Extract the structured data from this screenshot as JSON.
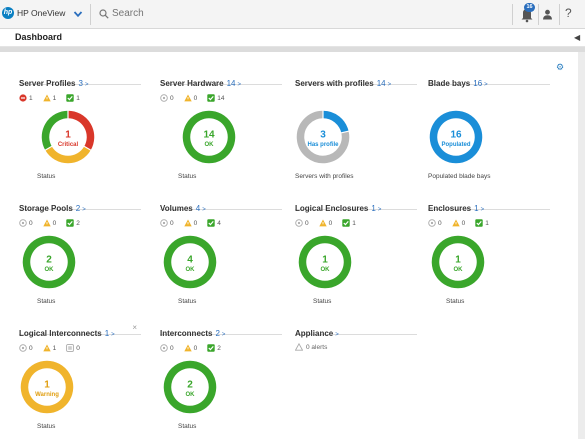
{
  "topbar": {
    "logo_text": "hp",
    "app_name": "HP OneView",
    "search_placeholder": "Search",
    "notification_count": "16",
    "help": "?"
  },
  "header": {
    "title": "Dashboard",
    "collapse": "◀"
  },
  "colors": {
    "ok": "#3aa62b",
    "critical": "#d9372a",
    "warning": "#f0b42c",
    "blue": "#1a8ed8",
    "grey": "#b8b8b8"
  },
  "panels": [
    {
      "title": "Server Profiles",
      "count": "3",
      "arrow": ">",
      "counts": [
        "1",
        "1",
        "1"
      ],
      "count_types": [
        "critical",
        "warning",
        "ok"
      ],
      "donut_value": "1",
      "donut_label": "Critical",
      "label_color": "#d9372a",
      "segments": [
        {
          "color": "#d9372a",
          "value": 1
        },
        {
          "color": "#f0b42c",
          "value": 1
        },
        {
          "color": "#3aa62b",
          "value": 1
        }
      ],
      "footer": "Status"
    },
    {
      "title": "Server Hardware",
      "count": "14",
      "arrow": ">",
      "counts": [
        "0",
        "0",
        "14"
      ],
      "count_types": [
        "unknown",
        "warning",
        "ok"
      ],
      "donut_value": "14",
      "donut_label": "OK",
      "label_color": "#3aa62b",
      "segments": [
        {
          "color": "#3aa62b",
          "value": 1
        }
      ],
      "footer": "Status"
    },
    {
      "title": "Servers with profiles",
      "count": "14",
      "arrow": ">",
      "counts": [],
      "count_types": [],
      "donut_value": "3",
      "donut_label": "Has profile",
      "label_color": "#1a8ed8",
      "segments": [
        {
          "color": "#1a8ed8",
          "value": 3
        },
        {
          "color": "#b8b8b8",
          "value": 11
        }
      ],
      "footer": "Servers with profiles"
    },
    {
      "title": "Blade bays",
      "count": "16",
      "arrow": ">",
      "counts": [],
      "count_types": [],
      "donut_value": "16",
      "donut_label": "Populated",
      "label_color": "#1a8ed8",
      "segments": [
        {
          "color": "#1a8ed8",
          "value": 1
        }
      ],
      "footer": "Populated blade bays"
    },
    {
      "title": "Storage Pools",
      "count": "2",
      "arrow": ">",
      "counts": [
        "0",
        "0",
        "2"
      ],
      "count_types": [
        "unknown",
        "warning",
        "ok"
      ],
      "donut_value": "2",
      "donut_label": "OK",
      "label_color": "#3aa62b",
      "segments": [
        {
          "color": "#3aa62b",
          "value": 1
        }
      ],
      "footer": "Status"
    },
    {
      "title": "Volumes",
      "count": "4",
      "arrow": ">",
      "counts": [
        "0",
        "0",
        "4"
      ],
      "count_types": [
        "unknown",
        "warning",
        "ok"
      ],
      "donut_value": "4",
      "donut_label": "OK",
      "label_color": "#3aa62b",
      "segments": [
        {
          "color": "#3aa62b",
          "value": 1
        }
      ],
      "footer": "Status"
    },
    {
      "title": "Logical Enclosures",
      "count": "1",
      "arrow": ">",
      "counts": [
        "0",
        "0",
        "1"
      ],
      "count_types": [
        "unknown",
        "warning",
        "ok"
      ],
      "donut_value": "1",
      "donut_label": "OK",
      "label_color": "#3aa62b",
      "segments": [
        {
          "color": "#3aa62b",
          "value": 1
        }
      ],
      "footer": "Status"
    },
    {
      "title": "Enclosures",
      "count": "1",
      "arrow": ">",
      "counts": [
        "0",
        "0",
        "1"
      ],
      "count_types": [
        "unknown",
        "warning",
        "ok"
      ],
      "donut_value": "1",
      "donut_label": "OK",
      "label_color": "#3aa62b",
      "segments": [
        {
          "color": "#3aa62b",
          "value": 1
        }
      ],
      "footer": "Status"
    },
    {
      "title": "Logical Interconnects",
      "count": "1",
      "arrow": ">",
      "close": "×",
      "counts": [
        "0",
        "1",
        "0"
      ],
      "count_types": [
        "unknown",
        "warning",
        "disabled"
      ],
      "donut_value": "1",
      "donut_label": "Warning",
      "label_color": "#e09e10",
      "segments": [
        {
          "color": "#f0b42c",
          "value": 1
        }
      ],
      "footer": "Status"
    },
    {
      "title": "Interconnects",
      "count": "2",
      "arrow": ">",
      "counts": [
        "0",
        "0",
        "2"
      ],
      "count_types": [
        "unknown",
        "warning",
        "ok"
      ],
      "donut_value": "2",
      "donut_label": "OK",
      "label_color": "#3aa62b",
      "segments": [
        {
          "color": "#3aa62b",
          "value": 1
        }
      ],
      "footer": "Status"
    },
    {
      "title": "Appliance",
      "count": "",
      "arrow": ">",
      "counts": [],
      "count_types": [],
      "alerts_text": "0 alerts",
      "footer": ""
    }
  ]
}
